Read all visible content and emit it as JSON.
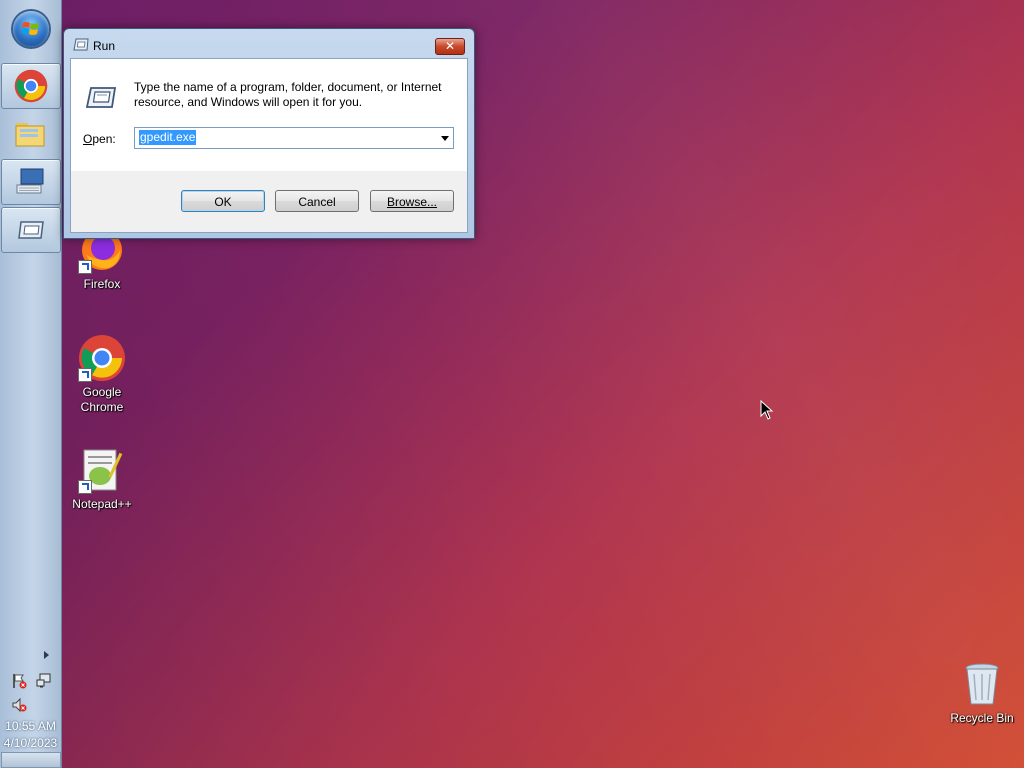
{
  "taskbar": {
    "start_icon": "windows-start-orb",
    "pinned": [
      {
        "name": "chrome",
        "icon": "chrome-icon"
      },
      {
        "name": "explorer",
        "icon": "folder-icon"
      },
      {
        "name": "keyboard",
        "icon": "keyboard-monitor-icon"
      },
      {
        "name": "run",
        "icon": "run-icon"
      }
    ],
    "clock": {
      "time": "10:55 AM",
      "date": "4/10/2023"
    }
  },
  "desktop": {
    "icons": [
      {
        "label": "Firefox",
        "icon": "firefox-icon"
      },
      {
        "label": "Google Chrome",
        "icon": "chrome-icon"
      },
      {
        "label": "Notepad++",
        "icon": "notepadpp-icon"
      },
      {
        "label": "Recycle Bin",
        "icon": "recycle-bin-icon"
      }
    ]
  },
  "run_dialog": {
    "title": "Run",
    "close_label": "✕",
    "description": "Type the name of a program, folder, document, or Internet resource, and Windows will open it for you.",
    "open_label_prefix": "O",
    "open_label_rest": "pen:",
    "open_value": "gpedit.exe",
    "ok_label": "OK",
    "cancel_label": "Cancel",
    "browse_label": "Browse..."
  }
}
